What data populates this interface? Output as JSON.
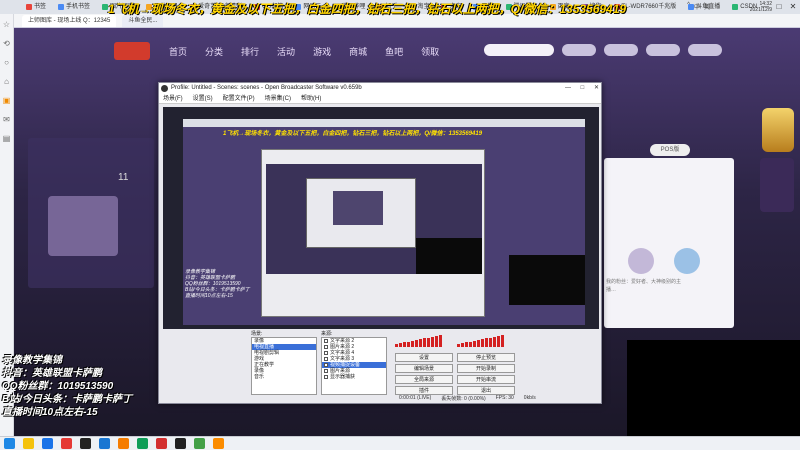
{
  "browser": {
    "tabs": [
      "书签",
      "手机书签",
      "图片识别",
      "开发工具",
      "爱奇艺-更多精彩",
      "QQ邮箱",
      "网易云",
      "哔哩哔哩",
      "知乎",
      "淘宝",
      "京东",
      "天猫",
      "腾讯视频",
      "百度",
      "搜狗",
      "TL-WDR7660千兆版",
      "斗鱼直播",
      "CSDN",
      "前端开发"
    ],
    "page_tabs": [
      "上师图库 - 现场上线 Q：12345",
      "斗鱼全民..."
    ],
    "window_controls": [
      "—",
      "□",
      "✕"
    ],
    "rail_icons": [
      "☆",
      "⟲",
      "○",
      "⌂",
      "▣",
      "✉",
      "▤"
    ]
  },
  "site": {
    "nav": [
      "首页",
      "分类",
      "排行",
      "活动",
      "游戏",
      "商城",
      "鱼吧",
      "领取"
    ],
    "pos_button": "POS版",
    "left_count": "11",
    "right_text": "我的粉丝：爱好者、大神级别的主播…"
  },
  "top_banner": "1飞机→现场冬衣，黄金及以下五把，白金四把，钻石三把，钻石以上两把，Q/微信：1353569419",
  "obs": {
    "title": "Profile: Untitled - Scenes: scenes - Open Broadcaster Software v0.659b",
    "window_controls": [
      "—",
      "□",
      "✕"
    ],
    "menu": [
      "场景(F)",
      "设置(S)",
      "配置文件(P)",
      "场景集(C)",
      "帮助(H)"
    ],
    "scenes_header": "场景:",
    "scenes": [
      "录像",
      "电视直播",
      "电视剧剪辑",
      "游戏",
      "正在教学",
      "录像",
      "音乐"
    ],
    "selected_scene": "电视直播",
    "sources_header": "来源:",
    "sources": [
      "文字来源 2",
      "图片来源 2",
      "文字来源 4",
      "文字来源 3",
      "视频捕捉设备",
      "图片来源",
      "显示器捕获"
    ],
    "selected_source": "视频捕捉设备",
    "buttons": {
      "settings": "设置",
      "stop_preview": "停止预览",
      "edit_scene": "编辑场景",
      "start_recording": "开始录制",
      "global_sources": "全局来源",
      "plugins": "插件",
      "exit": "退出",
      "start_stream": "开始串流"
    },
    "status": {
      "time": "0:00:01 (LIVE)",
      "dropped": "丢失帧数: 0 (0.00%)",
      "fps": "FPS: 30",
      "bitrate": "0kb/s"
    },
    "preview_banner": "1飞机→现场冬衣，黄金及以下五把，白金四把，钻石三把，钻石以上两把，Q/微信：1353569419",
    "preview_side": [
      "录像教学集锦",
      "抖音：英雄联盟卡萨鹏",
      "QQ粉丝群：1019513590",
      "B站/今日头条：卡萨鹏卡萨丁",
      "直播时间10点左右-15"
    ]
  },
  "overlay": [
    "录像教学集锦",
    "抖音：英雄联盟卡萨鹏",
    "QQ粉丝群：1019513590",
    "B站/今日头条：卡萨鹏卡萨丁",
    "直播时间10点左右-15"
  ],
  "taskbar": {
    "clock_time": "14:32",
    "clock_date": "2021/12/9",
    "tray": [
      "^",
      "中",
      "英"
    ],
    "icon_colors": [
      "#1e88e5",
      "#f4c20d",
      "#1a73e8",
      "#e53935",
      "#222222",
      "#1976d2",
      "#f57c00",
      "#0f9d58",
      "#d32f2f",
      "#212121",
      "#43a047",
      "#fb8c00"
    ]
  }
}
